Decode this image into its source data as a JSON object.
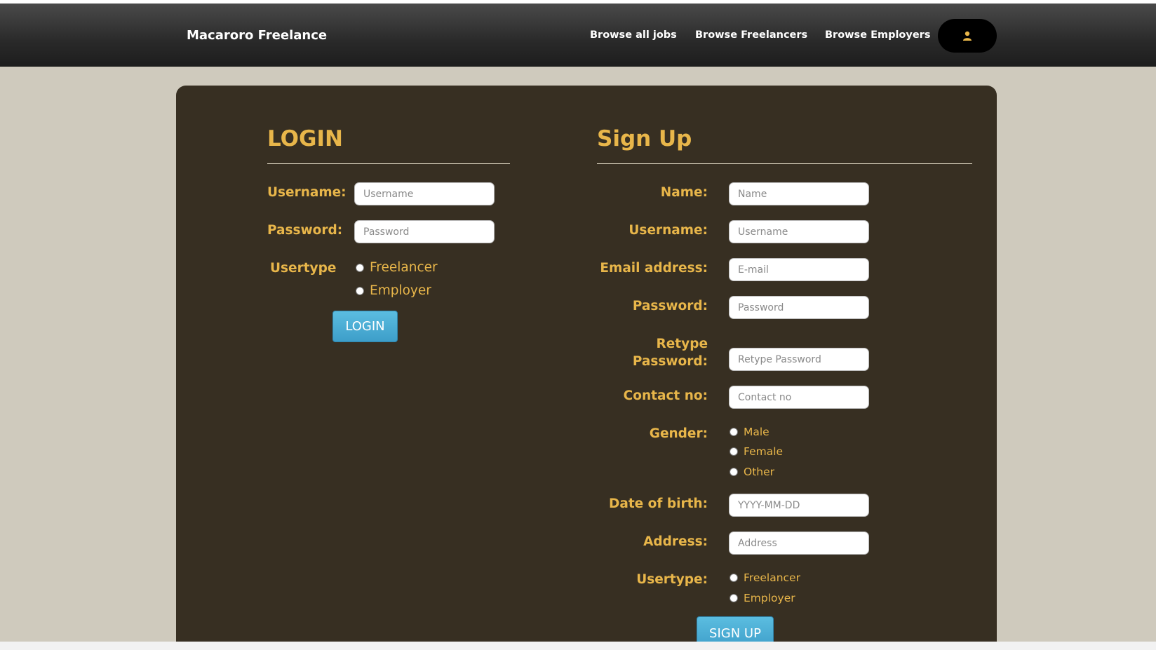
{
  "navbar": {
    "brand": "Macaroro Freelance",
    "links": [
      "Browse all jobs",
      "Browse Freelancers",
      "Browse Employers"
    ],
    "user_icon": "user-icon"
  },
  "login": {
    "title": "LOGIN",
    "username_label": "Username:",
    "username_placeholder": "Username",
    "password_label": "Password:",
    "password_placeholder": "Password",
    "usertype_label": "Usertype",
    "usertype_options": [
      "Freelancer",
      "Employer"
    ],
    "button": "LOGIN"
  },
  "signup": {
    "title": "Sign Up",
    "name_label": "Name:",
    "name_placeholder": "Name",
    "username_label": "Username:",
    "username_placeholder": "Username",
    "email_label": "Email address:",
    "email_placeholder": "E-mail",
    "password_label": "Password:",
    "password_placeholder": "Password",
    "retype_label_1": "Retype",
    "retype_label_2": "Password:",
    "retype_placeholder": "Retype Password",
    "contact_label": "Contact no:",
    "contact_placeholder": "Contact no",
    "gender_label": "Gender:",
    "gender_options": [
      "Male",
      "Female",
      "Other"
    ],
    "dob_label": "Date of birth:",
    "dob_placeholder": "YYYY-MM-DD",
    "address_label": "Address:",
    "address_placeholder": "Address",
    "usertype_label": "Usertype:",
    "usertype_options": [
      "Freelancer",
      "Employer"
    ],
    "button": "SIGN UP"
  },
  "colors": {
    "accent": "#e8b64a",
    "panel": "#372f22",
    "button": "#4aaed6"
  }
}
